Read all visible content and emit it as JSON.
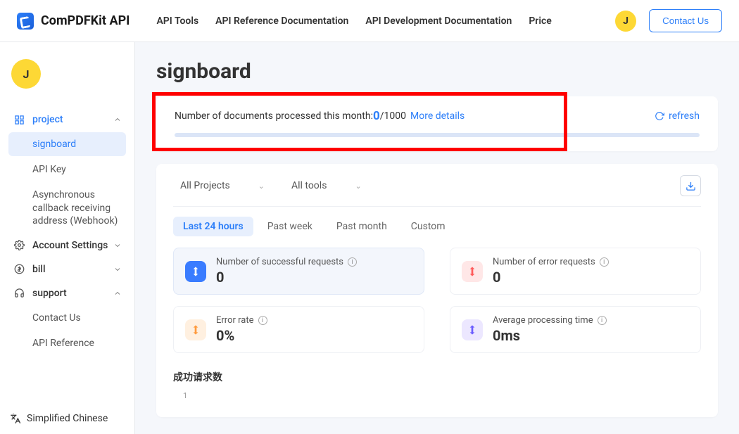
{
  "header": {
    "brand": "ComPDFKit API",
    "nav": [
      "API Tools",
      "API Reference Documentation",
      "API Development Documentation",
      "Price"
    ],
    "avatar_initial": "J",
    "contact_label": "Contact Us"
  },
  "sidebar": {
    "avatar_initial": "J",
    "groups": {
      "project": {
        "label": "project",
        "expanded": true,
        "items": [
          "signboard",
          "API Key",
          "Asynchronous callback receiving address (Webhook)"
        ],
        "active_index": 0
      },
      "account": {
        "label": "Account Settings"
      },
      "bill": {
        "label": "bill"
      },
      "support": {
        "label": "support",
        "items": [
          "Contact Us",
          "API Reference"
        ]
      }
    },
    "language": "Simplified Chinese"
  },
  "main": {
    "title": "signboard",
    "quota": {
      "prefix": "Number of documents processed this month: ",
      "used": "0",
      "sep": " / ",
      "total": "1000",
      "more": "More details",
      "refresh": "refresh"
    },
    "filters": {
      "project_select": "All Projects",
      "tool_select": "All tools"
    },
    "tabs": [
      "Last 24 hours",
      "Past week",
      "Past month",
      "Custom"
    ],
    "active_tab": 0,
    "stats": {
      "success": {
        "label": "Number of successful requests",
        "value": "0"
      },
      "error": {
        "label": "Number of error requests",
        "value": "0"
      },
      "rate": {
        "label": "Error rate",
        "value": "0%"
      },
      "avg": {
        "label": "Average processing time",
        "value": "0ms"
      }
    },
    "chart_title": "成功请求数",
    "chart_y_tick": "1"
  },
  "chart_data": {
    "type": "line",
    "title": "成功请求数",
    "ylabel": "",
    "ylim": [
      0,
      1
    ],
    "series": [
      {
        "name": "successful requests",
        "values": []
      }
    ],
    "note": "empty / no data for selected range"
  }
}
